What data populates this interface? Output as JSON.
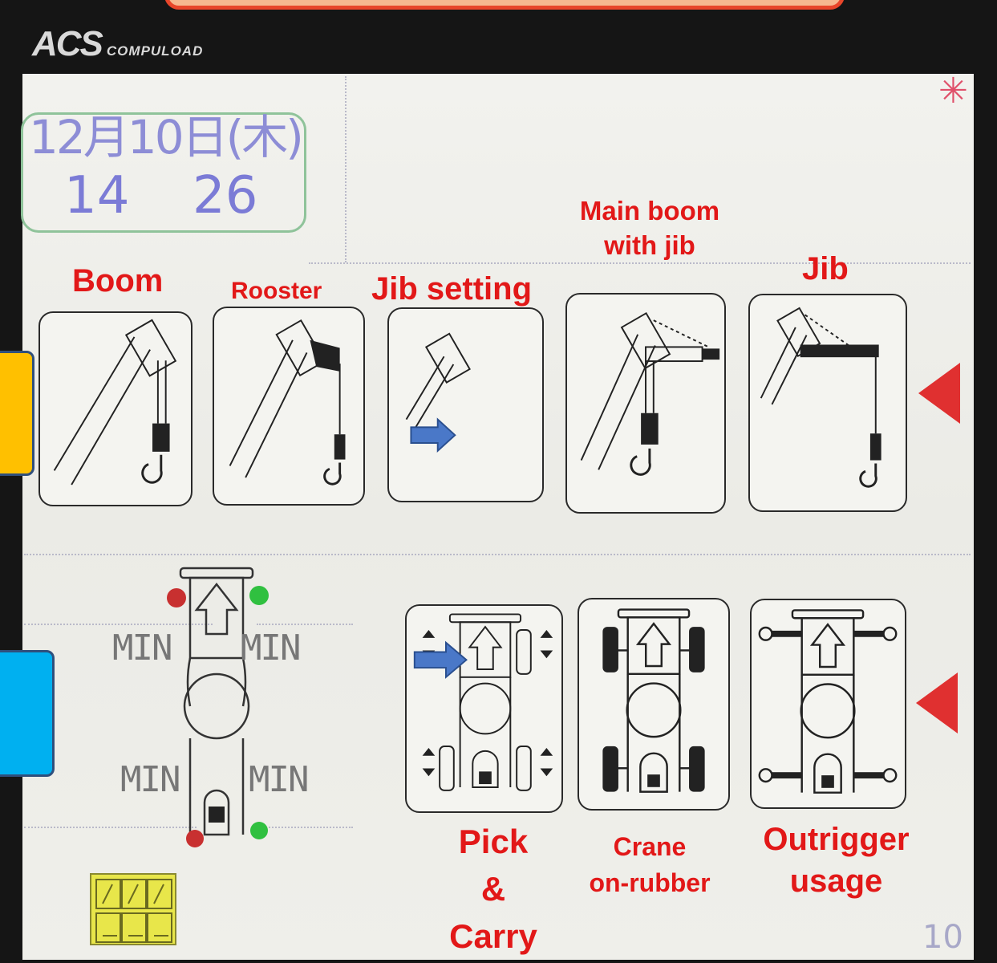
{
  "header": {
    "brand": "ACS",
    "brand_sub": "COMPULOAD"
  },
  "status": {
    "date": "12月10日(木)",
    "hour": "14",
    "minute": "26",
    "page": "10"
  },
  "boom_modes": [
    {
      "label": "Boom",
      "icon": "boom-hook-icon"
    },
    {
      "label": "Rooster",
      "icon": "rooster-sheave-icon"
    },
    {
      "label": "Jib setting",
      "icon": "jib-setting-icon"
    },
    {
      "label": "Main boom\nwith jib",
      "icon": "main-boom-with-jib-icon"
    },
    {
      "label": "Jib",
      "icon": "jib-hook-icon"
    }
  ],
  "carrier_modes": [
    {
      "label": "Pick\n&\nCarry",
      "icon": "pick-and-carry-icon"
    },
    {
      "label": "Crane\non-rubber",
      "icon": "crane-on-rubber-icon"
    },
    {
      "label": "Outrigger\nusage",
      "icon": "outrigger-usage-icon"
    }
  ],
  "outrigger_status": {
    "front_left": "MIN",
    "front_right": "MIN",
    "rear_left": "MIN",
    "rear_right": "MIN"
  },
  "colors": {
    "label_red": "#e21818",
    "selector_red": "#e03030",
    "arrow_blue": "#4472c4",
    "side_yellow": "#ffc000",
    "side_blue": "#00b0f0"
  }
}
